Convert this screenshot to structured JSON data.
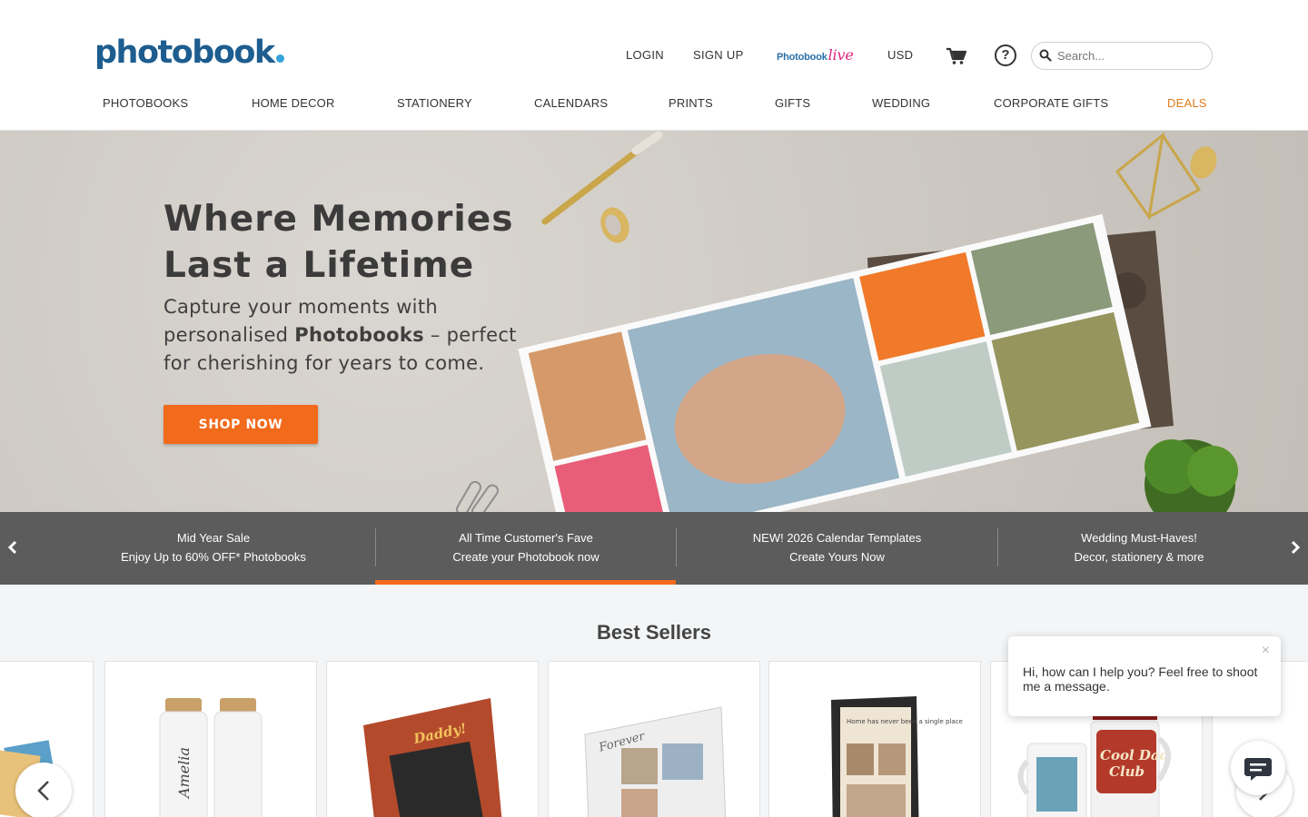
{
  "header": {
    "logo": "photobook",
    "top_links": {
      "login": "LOGIN",
      "signup": "SIGN UP",
      "live_brand": "Photobook",
      "live_script": "live",
      "currency": "USD"
    },
    "search": {
      "placeholder": "Search..."
    },
    "help_glyph": "?"
  },
  "nav": {
    "items": [
      "PHOTOBOOKS",
      "HOME DECOR",
      "STATIONERY",
      "CALENDARS",
      "PRINTS",
      "GIFTS",
      "WEDDING",
      "CORPORATE GIFTS",
      "DEALS"
    ],
    "deals_color": "#e07b1a"
  },
  "hero": {
    "title_line1": "Where Memories",
    "title_line2": "Last a Lifetime",
    "sub_before": "Capture your moments with personalised ",
    "sub_bold": "Photobooks",
    "sub_after": " – perfect for cherishing for years to come.",
    "cta": "SHOP NOW"
  },
  "promo": [
    {
      "line1": "Mid Year Sale ",
      "line2": "Enjoy Up to 60% OFF* Photobooks "
    },
    {
      "line1": "All Time Customer's Fave ",
      "line2": "Create your Photobook now"
    },
    {
      "line1": "NEW! 2026 Calendar Templates",
      "line2": "Create Yours Now"
    },
    {
      "line1": "Wedding Must-Haves!",
      "line2": "Decor, stationery & more"
    }
  ],
  "best_sellers": {
    "title": "Best Sellers",
    "bottle_name": "Amelia",
    "book_title": "Daddy!",
    "album_script": "Forever",
    "frame_text": "Home has never been a single place",
    "mug_text_1": "Cool Dad",
    "mug_text_2": "Club"
  },
  "chat": {
    "message": "Hi, how can I help you? Feel free to shoot me a message.",
    "close": "×"
  },
  "colors": {
    "brand_blue": "#1d5d8f",
    "accent_orange": "#f26a1b",
    "promo_bg": "#464646"
  }
}
